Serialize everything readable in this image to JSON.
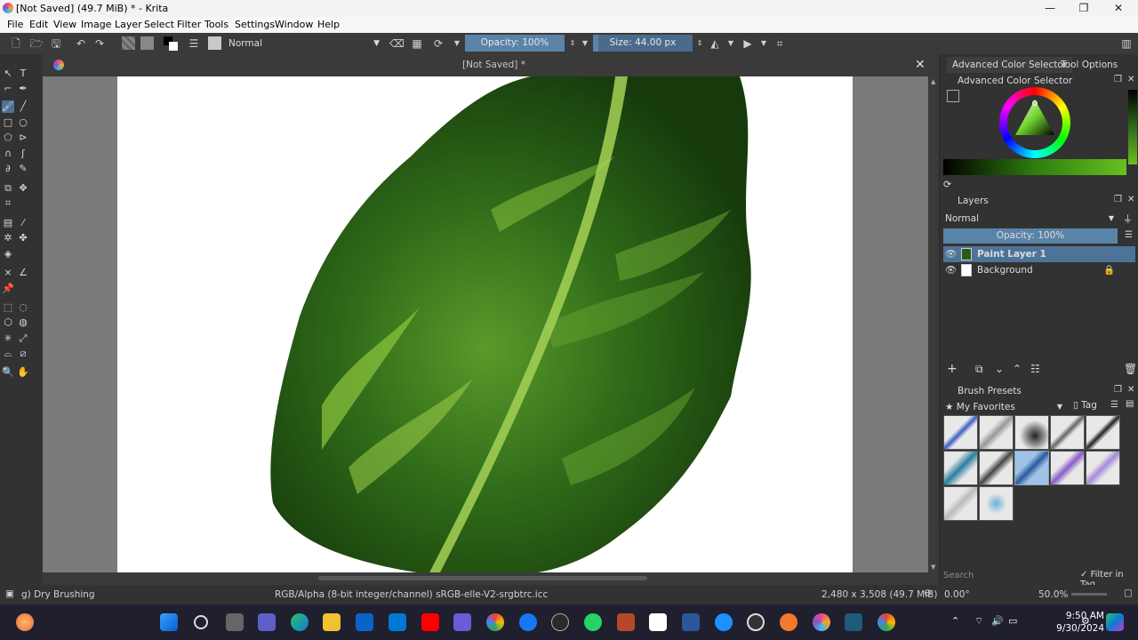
{
  "window": {
    "title": "[Not Saved]  (49.7 MiB)  * - Krita",
    "minimize": "—",
    "maximize": "❐",
    "close": "✕"
  },
  "menu": [
    "File",
    "Edit",
    "View",
    "Image",
    "Layer",
    "Select",
    "Filter",
    "Tools",
    "Settings",
    "Window",
    "Help"
  ],
  "toolbar": {
    "blend_mode": "Normal",
    "opacity": "Opacity: 100%",
    "opacity_value": 1.0,
    "size": "Size: 44.00 px",
    "size_fill": 0.05
  },
  "canvas": {
    "tab_title": "[Not Saved]  *",
    "close": "✕"
  },
  "docker": {
    "tabs": [
      "Advanced Color Selector",
      "Tool Options"
    ],
    "color_selector_title": "Advanced Color Selector",
    "layers_title": "Layers",
    "layers_blend": "Normal",
    "layers_opacity": "Opacity:  100%",
    "layers": [
      {
        "name": "Paint Layer 1",
        "selected": true
      },
      {
        "name": "Background",
        "selected": false
      }
    ],
    "brush_presets_title": "Brush Presets",
    "brush_group": "My Favorites",
    "tag_label": "Tag",
    "search_placeholder": "Search",
    "filter_in_tag": "Filter in Tag"
  },
  "status": {
    "brush": "g) Dry Brushing",
    "color_info": "RGB/Alpha (8-bit integer/channel)  sRGB-elle-V2-srgbtrc.icc",
    "doc_size": "2,480 x 3,508 (49.7 MiB)",
    "rotation": "0.00°",
    "zoom": "50.0%"
  },
  "taskbar": {
    "time": "9:50 AM",
    "date": "9/30/2024"
  },
  "colors": {
    "accent": "#4e7399",
    "leaf_dark": "#1f4a14",
    "leaf_light": "#8ec63f"
  }
}
